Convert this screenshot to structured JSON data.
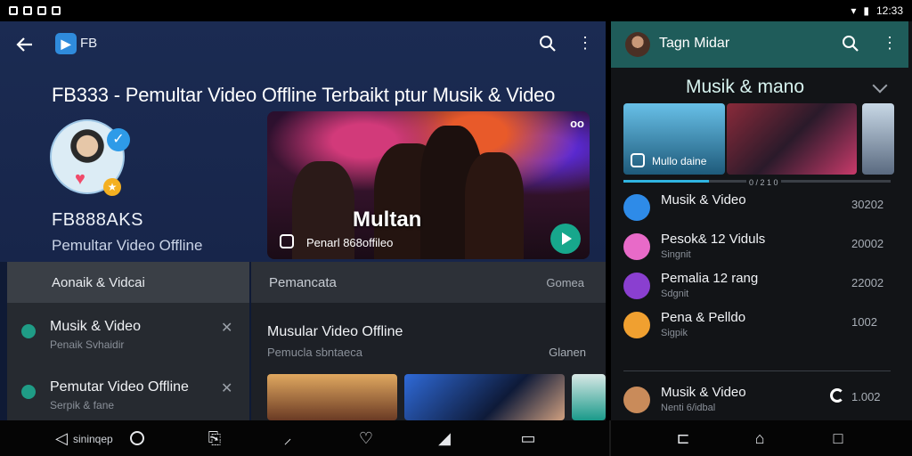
{
  "status_bar": {
    "time": "12:33"
  },
  "left": {
    "app_short": "FB",
    "page_title": "FB333 - Pemultar Video Offline Terbaikt ptur Musik & Video",
    "profile": {
      "name": "FB888AKS",
      "subtitle": "Pemultar Video Offline"
    },
    "hero": {
      "title": "Multan",
      "subtitle": "Penarl 868offileo",
      "corner_label": "oo"
    },
    "list": {
      "header": "Aonaik & Vidcai",
      "items": [
        {
          "title": "Musik & Video",
          "subtitle": "Penaik Svhaidir"
        },
        {
          "title": "Pemutar Video Offline",
          "subtitle": "Serpik & fane"
        }
      ]
    },
    "content": {
      "header": "Pemancata",
      "header_right": "Gomea",
      "title": "Musular Video Offline",
      "subtitle": "Pemucla sbntaeca",
      "link": "Glanen"
    }
  },
  "right": {
    "title": "Tagn Midar",
    "section": "Musik & mano",
    "card_label": "Mullo daine",
    "progress_text": "0 / 2 1 0",
    "progress_fraction": 0.32,
    "items": [
      {
        "title": "Musik & Video",
        "subtitle": "",
        "count": "30202",
        "color": "#2e8be8"
      },
      {
        "title": "Pesok& 12 Viduls",
        "subtitle": "Singnit",
        "count": "20002",
        "color": "#e86ac8"
      },
      {
        "title": "Pemalia 12 rang",
        "subtitle": "Sdgnit",
        "count": "22002",
        "color": "#8a3fd0"
      },
      {
        "title": "Pena & Pelldo",
        "subtitle": "Sigpik",
        "count": "1002",
        "color": "#f0a030"
      },
      {
        "title": "Musik & Video",
        "subtitle": "Nenti 6/idbal",
        "count": "1.002",
        "color": "#c98b5a"
      }
    ]
  },
  "navbar": {
    "label": "sininqep"
  }
}
